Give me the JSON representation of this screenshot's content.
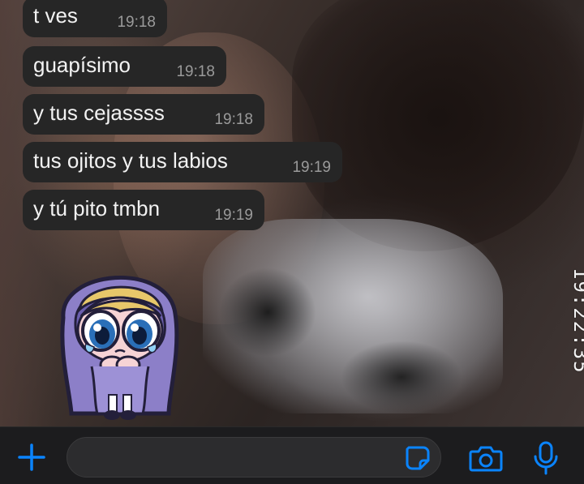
{
  "messages": [
    {
      "text": "t ves",
      "time": "19:18"
    },
    {
      "text": "guapísimo",
      "time": "19:18"
    },
    {
      "text": "y tus cejassss",
      "time": "19:18"
    },
    {
      "text": "tus ojitos y tus labios",
      "time": "19:19"
    },
    {
      "text": "y tú pito tmbn",
      "time": "19:19"
    }
  ],
  "wallpaper": {
    "timestamp": "19:22:35"
  },
  "sticker": {
    "icon": "crying-cartoon-girl-sticker"
  },
  "input_bar": {
    "placeholder": "",
    "value": "",
    "icons": {
      "plus": "plus-icon",
      "sticker": "sticker-icon",
      "camera": "camera-icon",
      "mic": "microphone-icon"
    },
    "accent_color": "#0a84ff"
  },
  "colors": {
    "bubble": "#262626",
    "text": "#f2f2f2",
    "time": "#9a9a9a",
    "bar": "#1c1c1e"
  }
}
